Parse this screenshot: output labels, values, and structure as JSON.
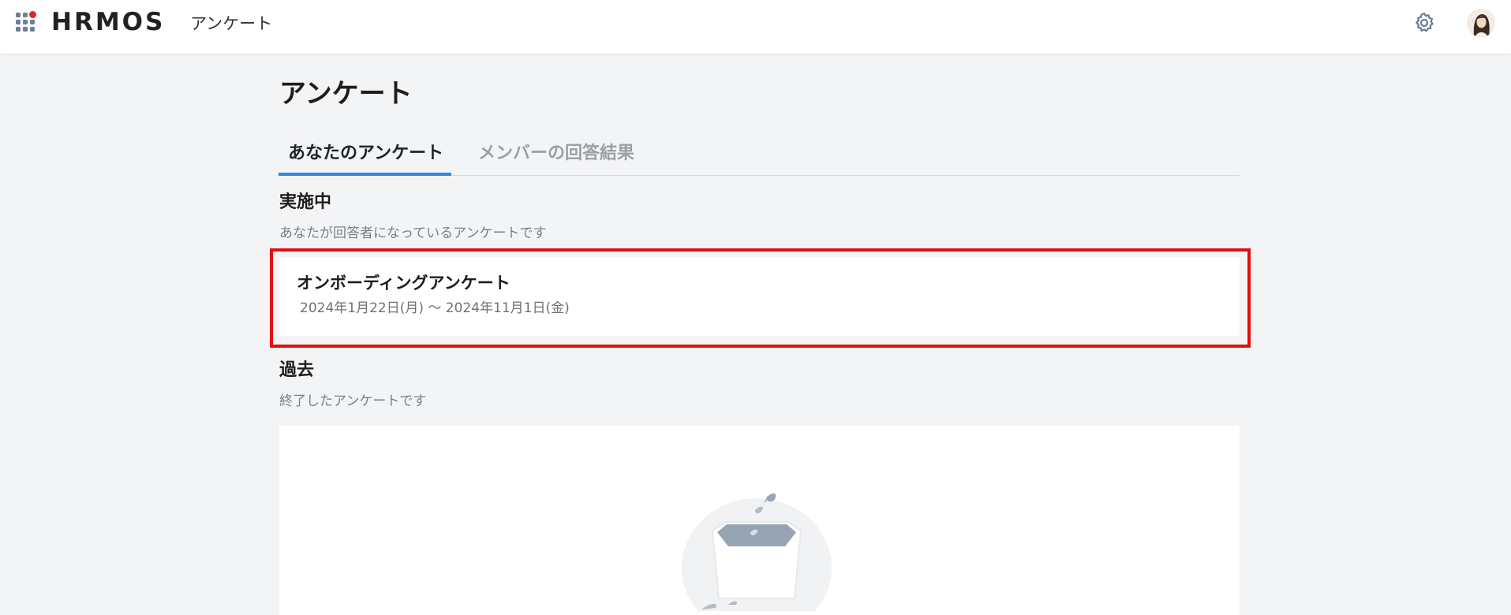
{
  "header": {
    "logo_text": "HRMOS",
    "app_name": "アンケート",
    "icons": [
      "apps-grid-icon",
      "gear-icon",
      "user-avatar"
    ]
  },
  "page": {
    "title": "アンケート"
  },
  "tabs": [
    {
      "label": "あなたのアンケート",
      "active": true
    },
    {
      "label": "メンバーの回答結果",
      "active": false
    }
  ],
  "sections": {
    "active": {
      "heading": "実施中",
      "description": "あなたが回答者になっているアンケートです",
      "surveys": [
        {
          "title": "オンボーディングアンケート",
          "period": "2024年1月22日(月) 〜 2024年11月1日(金)"
        }
      ]
    },
    "past": {
      "heading": "過去",
      "description": "終了したアンケートです"
    }
  },
  "colors": {
    "accent": "#2e88df",
    "highlight": "#e30d0d",
    "background": "#f3f4f6"
  }
}
